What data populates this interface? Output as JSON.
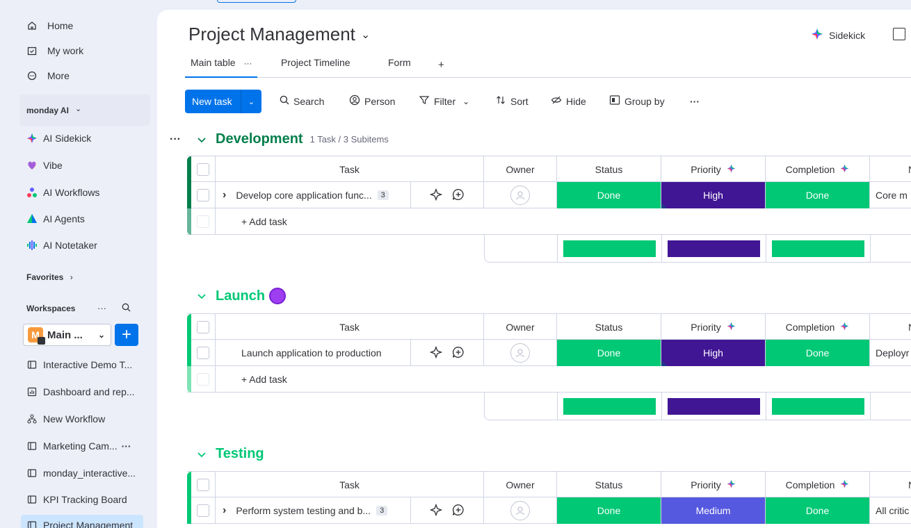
{
  "sidebar": {
    "nav": [
      {
        "label": "Home",
        "icon": "home-icon"
      },
      {
        "label": "My work",
        "icon": "calendar-check-icon"
      },
      {
        "label": "More",
        "icon": "more-circle-icon"
      }
    ],
    "ai_section": {
      "label": "monday AI",
      "chevron": "⌄",
      "items": [
        {
          "label": "AI Sidekick",
          "icon": "sidekick-icon"
        },
        {
          "label": "Vibe",
          "icon": "vibe-icon"
        },
        {
          "label": "AI Workflows",
          "icon": "ai-workflows-icon"
        },
        {
          "label": "AI Agents",
          "icon": "ai-agents-icon"
        },
        {
          "label": "AI Notetaker",
          "icon": "ai-notetaker-icon"
        }
      ]
    },
    "favorites_label": "Favorites",
    "favorites_chevron": "›",
    "workspaces_label": "Workspaces",
    "workspaces_dots": "···",
    "workspace": {
      "avatar_letter": "M",
      "name": "Main ...",
      "chevron": "⌄"
    },
    "add_label": "+",
    "boards": [
      {
        "label": "Interactive Demo T...",
        "icon": "board-icon"
      },
      {
        "label": "Dashboard and rep...",
        "icon": "dashboard-icon"
      },
      {
        "label": "New Workflow",
        "icon": "workflow-icon"
      },
      {
        "label": "Marketing Cam...",
        "icon": "board-icon",
        "extra": "···"
      },
      {
        "label": "monday_interactive...",
        "icon": "board-icon"
      },
      {
        "label": "KPI Tracking Board",
        "icon": "board-icon"
      },
      {
        "label": "Project Management",
        "icon": "board-icon"
      }
    ]
  },
  "header": {
    "title": "Project Management",
    "title_chevron": "⌄",
    "sidekick_label": "Sidekick",
    "tabs": [
      {
        "label": "Main table",
        "extra": "···"
      },
      {
        "label": "Project Timeline"
      },
      {
        "label": "Form"
      },
      {
        "label": "+"
      }
    ]
  },
  "toolbar": {
    "new_task": "New task",
    "new_task_dd": "⌄",
    "search": "Search",
    "person": "Person",
    "filter": "Filter",
    "filter_dd": "⌄",
    "sort": "Sort",
    "hide": "Hide",
    "group_by": "Group by",
    "more": "···"
  },
  "columns": {
    "task": "Task",
    "owner": "Owner",
    "status": "Status",
    "priority": "Priority",
    "completion": "Completion",
    "next_col": "N"
  },
  "groups": [
    {
      "title": "Development",
      "count": "1 Task / 3 Subitems",
      "color": "#037f4c",
      "rows": [
        {
          "task": "Develop core application func...",
          "subitems": "3",
          "expand": "›",
          "status": "Done",
          "priority": "High",
          "completion": "Done",
          "note": "Core m"
        }
      ],
      "add_task": "+ Add task"
    },
    {
      "title": "Launch",
      "count": "",
      "color": "#00c875",
      "rows": [
        {
          "task": "Launch application to production",
          "subitems": "",
          "expand": "",
          "status": "Done",
          "priority": "High",
          "completion": "Done",
          "note": "Deployr"
        }
      ],
      "add_task": "+ Add task"
    },
    {
      "title": "Testing",
      "count": "",
      "color": "#00c875",
      "rows": [
        {
          "task": "Perform system testing and b...",
          "subitems": "3",
          "expand": "›",
          "status": "Done",
          "priority": "Medium",
          "completion": "Done",
          "note": "All critic"
        }
      ],
      "add_task": ""
    }
  ],
  "colors": {
    "done": "#00c875",
    "high": "#401694",
    "medium": "#5559df",
    "accent": "#0073ea"
  },
  "group_dots": "···"
}
